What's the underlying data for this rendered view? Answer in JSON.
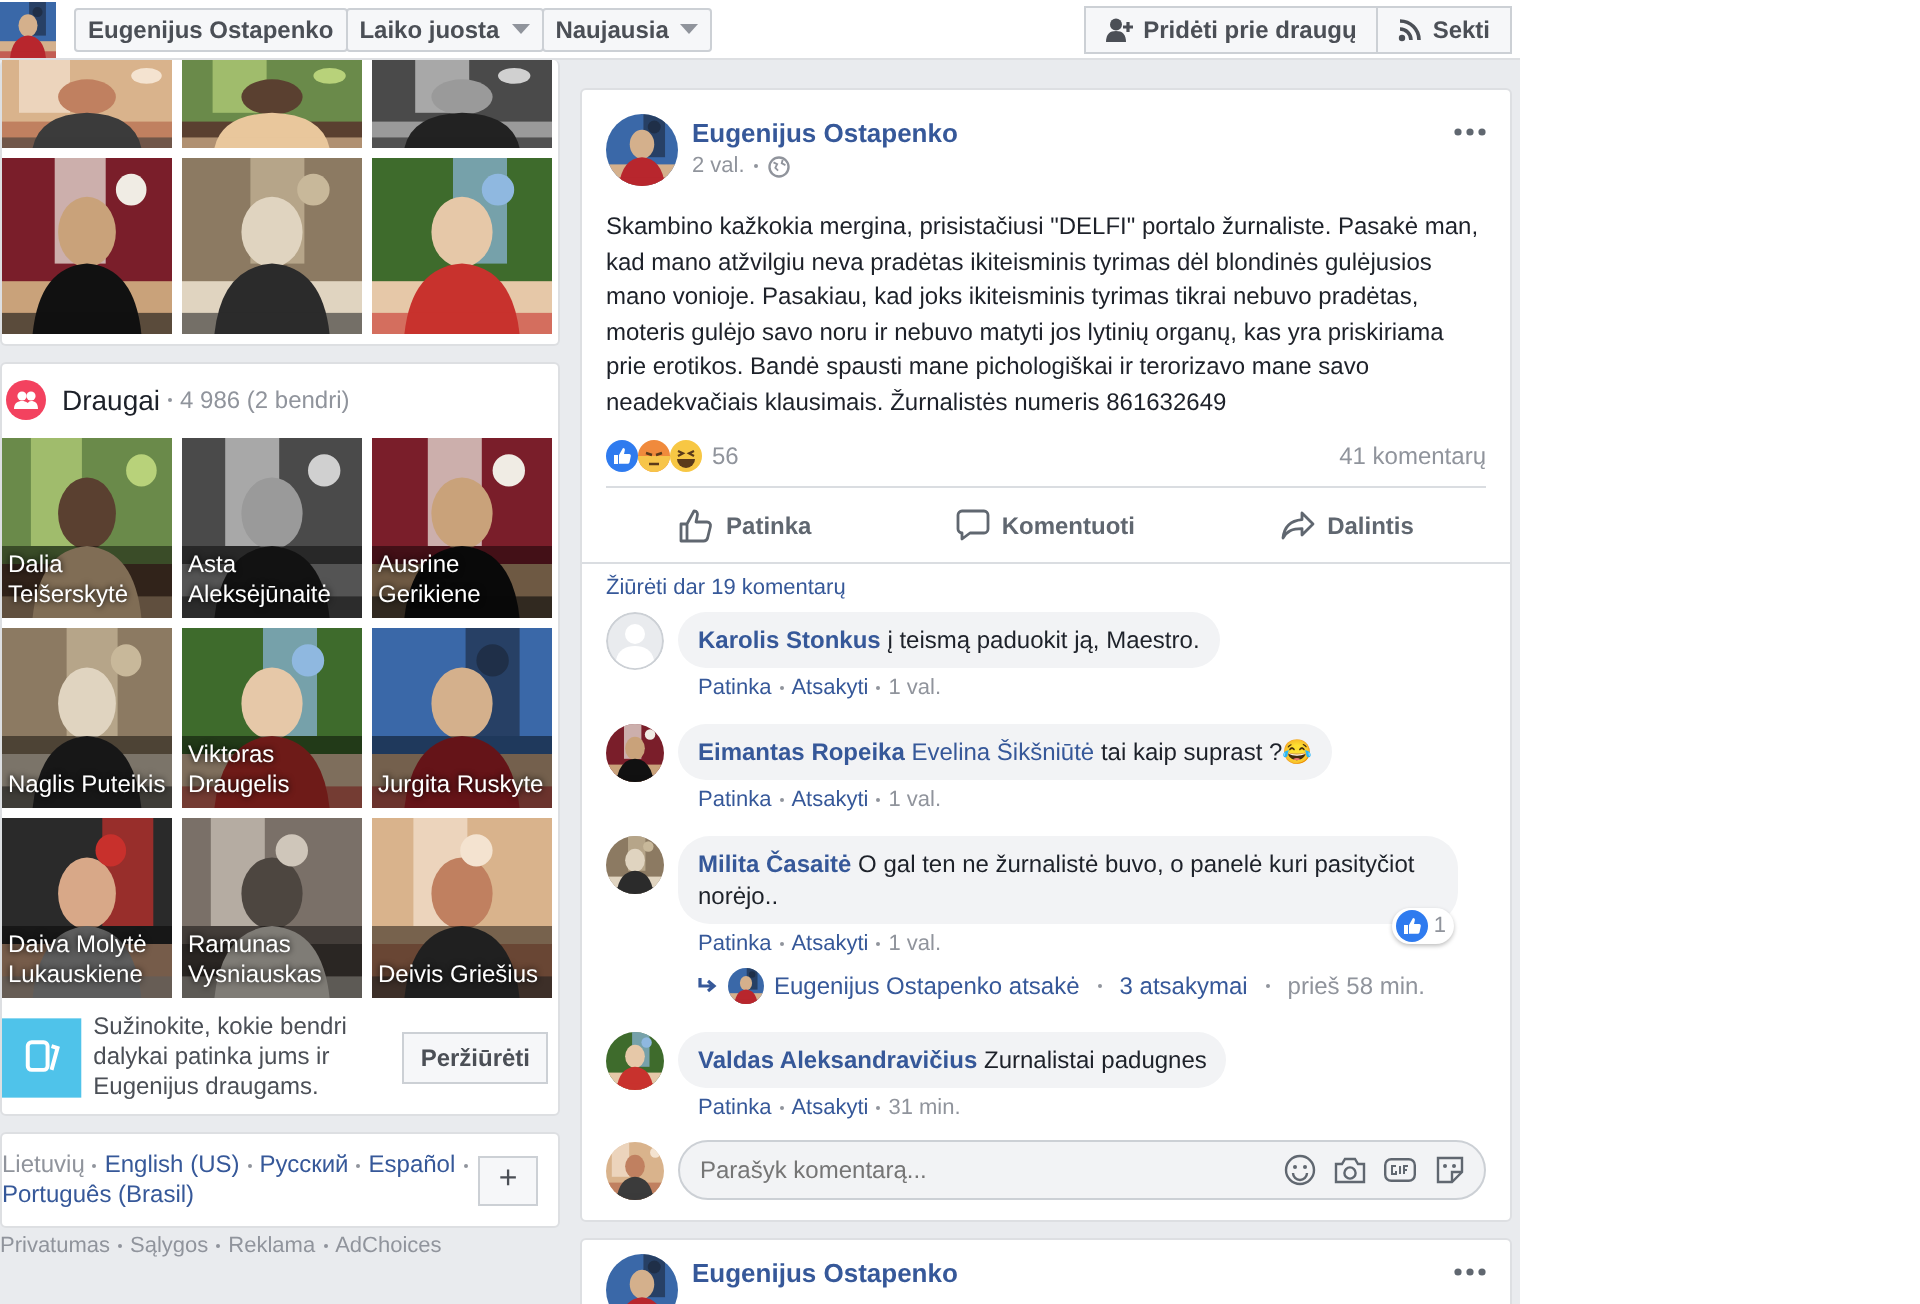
{
  "profile_bar": {
    "name": "Eugenijus Ostapenko",
    "filters": [
      {
        "label": "Laiko juosta",
        "dropdown": true
      },
      {
        "label": "Naujausia",
        "dropdown": true
      }
    ],
    "actions": [
      {
        "label": "Pridėti prie draugų",
        "kind": "add-friend"
      },
      {
        "label": "Sekti",
        "kind": "follow"
      }
    ]
  },
  "photos": [
    {
      "kind": "picture"
    },
    {
      "kind": "picture"
    },
    {
      "kind": "picture"
    },
    {
      "kind": "picture"
    },
    {
      "kind": "picture"
    },
    {
      "kind": "picture"
    }
  ],
  "friends": {
    "title": "Draugai",
    "count": "4 986 (2 bendri)",
    "items": [
      {
        "name": "Dalia Teišerskytė"
      },
      {
        "name": "Asta Aleksėjūnaitė"
      },
      {
        "name": "Ausrine Gerikiene"
      },
      {
        "name": "Naglis Puteikis"
      },
      {
        "name": "Viktoras Draugelis"
      },
      {
        "name": "Jurgita Ruskyte"
      },
      {
        "name": "Daiva Molytė Lukauskiene"
      },
      {
        "name": "Ramunas Vysniauskas"
      },
      {
        "name": "Deivis Griešius"
      }
    ],
    "promo": {
      "text": "Sužinokite, kokie bendri dalykai patinka jums ir Eugenijus draugams.",
      "button": "Peržiūrėti"
    }
  },
  "languages": {
    "items": [
      {
        "label": "Lietuvių",
        "selected": true
      },
      {
        "label": "English (US)",
        "selected": false
      },
      {
        "label": "Русский",
        "selected": false
      },
      {
        "label": "Español",
        "selected": false
      },
      {
        "label": "Português (Brasil)",
        "selected": false
      }
    ],
    "more_button": "+"
  },
  "footer_links": [
    "Privatumas",
    "Sąlygos",
    "Reklama",
    "AdChoices"
  ],
  "posts": [
    {
      "author": "Eugenijus Ostapenko",
      "time": "2 val.",
      "body": "Skambino kažkokia mergina, prisistačiusi \"DELFI\" portalo žurnaliste. Pasakė man, kad mano atžvilgiu neva pradėtas ikiteisminis tyrimas dėl blondinės gulėjusios mano vonioje. Pasakiau, kad joks ikiteisminis tyrimas tikrai nebuvo pradėtas, moteris gulėjo savo noru ir nebuvo matyti jos lytinių organų, kas yra priskiriama prie erotikos. Bandė spausti mane pichologiškai ir terorizavo mane savo neadekvačiais klausimais. Žurnalistės numeris 861632649",
      "reaction_count": "56",
      "comment_count": "41 komentarų",
      "actions": [
        {
          "label": "Patinka",
          "kind": "like"
        },
        {
          "label": "Komentuoti",
          "kind": "comment"
        },
        {
          "label": "Dalintis",
          "kind": "share"
        }
      ],
      "more_comments": "Žiūrėti dar 19 komentarų",
      "comments": [
        {
          "author": "Karolis Stonkus",
          "kind": "default",
          "text": "į teismą paduokit ją, Maestro.",
          "links": [
            "Patinka",
            "Atsakyti"
          ],
          "time": "1 val."
        },
        {
          "author": "Eimantas Ropeika",
          "mention": "Evelina Šikšniūtė",
          "text": "tai kaip suprast ?😂",
          "links": [
            "Patinka",
            "Atsakyti"
          ],
          "time": "1 val."
        },
        {
          "author": "Milita Časaitė",
          "text": "O gal ten ne žurnalistė buvo, o panelė kuri pasityčiot norėjo..",
          "reaction_count": "1",
          "links": [
            "Patinka",
            "Atsakyti"
          ],
          "time": "1 val.",
          "replies": {
            "who": "Eugenijus Ostapenko atsakė",
            "count": "3 atsakymai",
            "time": "prieš 58 min."
          }
        },
        {
          "author": "Valdas Aleksandravičius",
          "text": "Zurnalistai padugnes",
          "links": [
            "Patinka",
            "Atsakyti"
          ],
          "time": "31 min."
        }
      ],
      "composer": {
        "placeholder": "Parašyk komentarą..."
      }
    },
    {
      "author": "Eugenijus Ostapenko"
    }
  ]
}
